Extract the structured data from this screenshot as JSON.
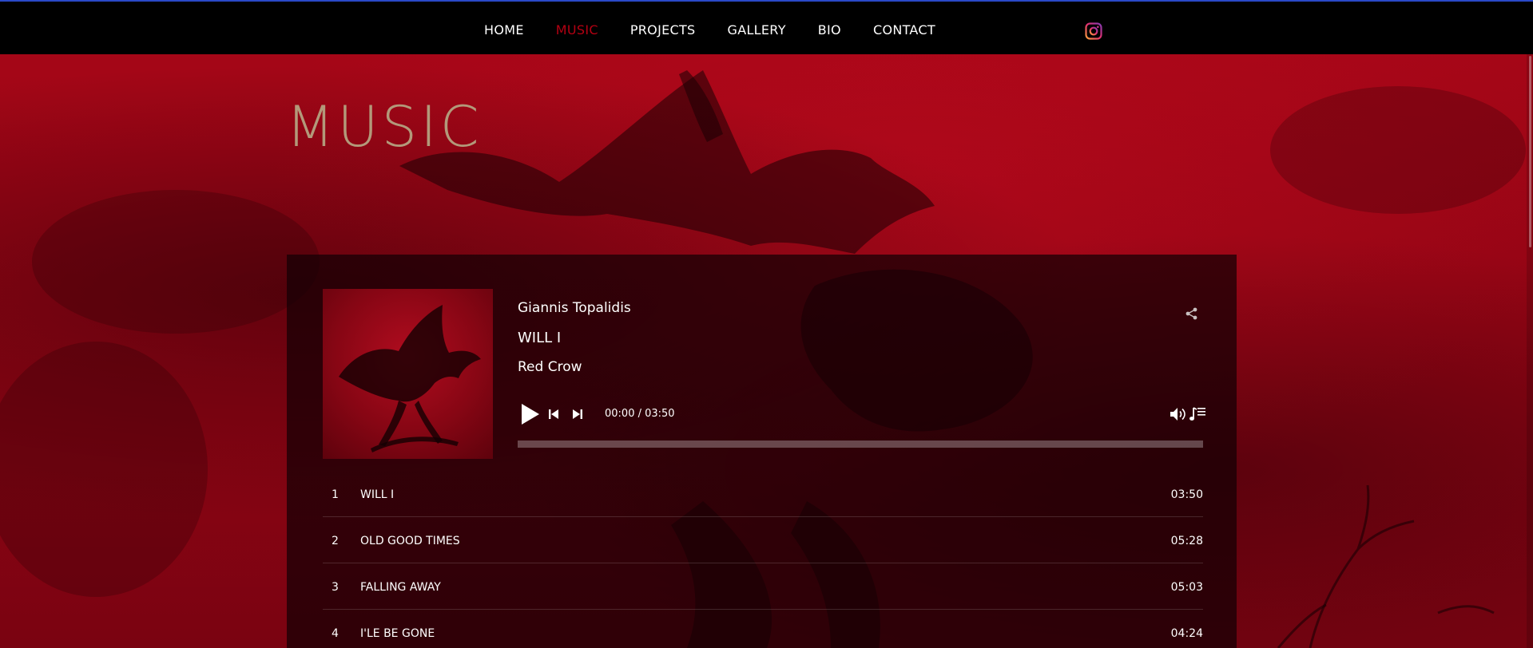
{
  "header": {
    "nav": [
      {
        "label": "HOME",
        "active": false
      },
      {
        "label": "MUSIC",
        "active": true
      },
      {
        "label": "PROJECTS",
        "active": false
      },
      {
        "label": "GALLERY",
        "active": false
      },
      {
        "label": "BIO",
        "active": false
      },
      {
        "label": "CONTACT",
        "active": false
      }
    ],
    "social_icon": "instagram-icon"
  },
  "page": {
    "title": "MUSIC"
  },
  "player": {
    "artist": "Giannis Topalidis",
    "track_title": "WILL I",
    "album": "Red Crow",
    "time": "00:00 / 03:50",
    "progress": 0,
    "icons": {
      "play": "play-icon",
      "previous": "skip-previous-icon",
      "next": "skip-next-icon",
      "volume": "volume-icon",
      "playlist": "playlist-icon",
      "share": "share-icon"
    }
  },
  "tracks": [
    {
      "number": "1",
      "title": "WILL I",
      "duration": "03:50"
    },
    {
      "number": "2",
      "title": "OLD GOOD TIMES",
      "duration": "05:28"
    },
    {
      "number": "3",
      "title": "FALLING AWAY",
      "duration": "05:03"
    },
    {
      "number": "4",
      "title": "I'LE BE GONE",
      "duration": "04:24"
    }
  ],
  "colors": {
    "accent": "#b30012",
    "title": "#b3997a",
    "background_red": "#a50617",
    "nav_bar": "#000000"
  }
}
